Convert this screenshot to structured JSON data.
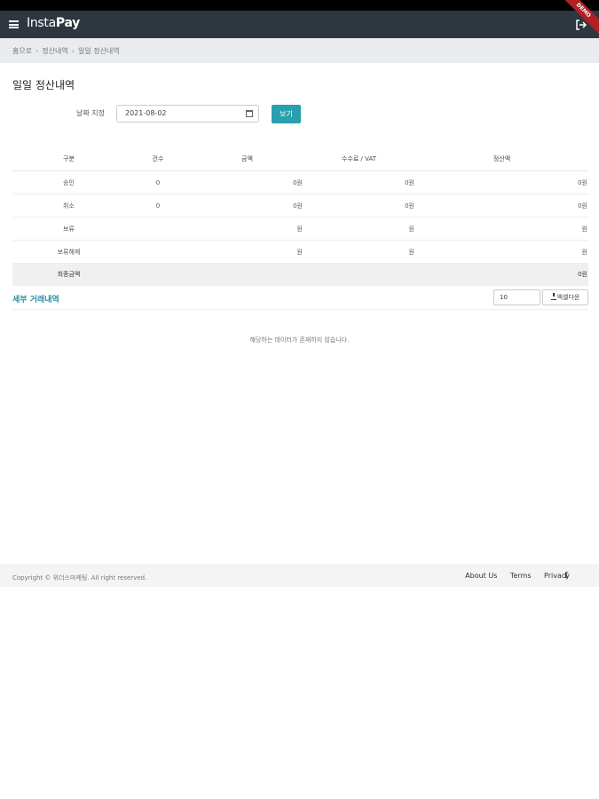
{
  "navbar": {
    "brand_light": "Insta",
    "brand_bold": "Pay",
    "ribbon": "DEMO"
  },
  "breadcrumb": [
    "홈으로",
    "정산내역",
    "일일 정산내역"
  ],
  "page": {
    "title": "일일 정산내역"
  },
  "filter": {
    "date_label": "날짜 지정",
    "date_value": "2021-08-02",
    "view_label": "보기"
  },
  "summary_table": {
    "headers": [
      "구분",
      "건수",
      "금액",
      "수수료 / VAT",
      "정산액"
    ],
    "rows": [
      [
        "승인",
        "0",
        "0원",
        "0원",
        "0원"
      ],
      [
        "취소",
        "0",
        "0원",
        "0원",
        "0원"
      ],
      [
        "보류",
        "",
        "원",
        "원",
        "원"
      ],
      [
        "보류해제",
        "",
        "원",
        "원",
        "원"
      ],
      [
        "최종금액",
        "",
        "",
        "",
        "0원"
      ]
    ]
  },
  "details": {
    "title": "세부 거래내역",
    "page_size": "10",
    "excel_label": "엑셀다운",
    "empty_message": "해당하는 데이터가 존재하지 않습니다."
  },
  "footer": {
    "copyright": "Copyright © 위더스마케팅. All right reserved.",
    "links": [
      "About Us",
      "Terms",
      "Privacy"
    ]
  },
  "colors": {
    "navbar": "#2e363f",
    "accent": "#2a9fae",
    "ribbon": "#b21f24"
  }
}
